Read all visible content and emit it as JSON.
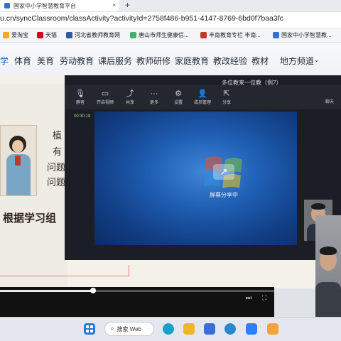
{
  "browser": {
    "tab_title": "国家中小学智慧教育平台",
    "tab_close": "×",
    "new_tab": "+",
    "address": "u.cn/syncClassroom/classActivity?activityId=2758f486-b951-4147-8769-6bd0f7baa3fc",
    "bookmarks": [
      {
        "label": "爱淘宝",
        "color": "#f5a623"
      },
      {
        "label": "天猫",
        "color": "#d0021b"
      },
      {
        "label": "河北省教师教育网",
        "color": "#2c5aa0"
      },
      {
        "label": "唐山市师生健康信...",
        "color": "#3bb36d"
      },
      {
        "label": "丰南教育专栏  丰南...",
        "color": "#c0392b"
      },
      {
        "label": "国家中小学智慧教...",
        "color": "#2f6fd6"
      }
    ]
  },
  "site_nav": {
    "items": [
      "学",
      "体育",
      "美育",
      "劳动教育",
      "课后服务",
      "教师研修",
      "家庭教育",
      "教改经验",
      "教材",
      "地方频道"
    ],
    "dropdown_icon": "chevron-down-icon",
    "accent": "#1e63c8"
  },
  "slide": {
    "lines": [
      "植",
      "有",
      "问题",
      "问题"
    ],
    "big_line": "根据学习组"
  },
  "meeting": {
    "title": "多位教来一位教（例7）",
    "record_time": "00:30:18",
    "tools": [
      {
        "icon": "mic-icon",
        "glyph": "🎙",
        "label": "静音"
      },
      {
        "icon": "camera-icon",
        "glyph": "▭",
        "label": "开启视频"
      },
      {
        "icon": "share-icon",
        "glyph": "⤴",
        "label": "共享"
      },
      {
        "icon": "more-icon",
        "glyph": "···",
        "label": "更多"
      },
      {
        "icon": "settings-icon",
        "glyph": "⚙",
        "label": "设置"
      },
      {
        "icon": "members-icon",
        "glyph": "👤",
        "label": "成员管理"
      },
      {
        "icon": "leave-icon",
        "glyph": "⇱",
        "label": "分享"
      }
    ],
    "side_label": "聊天",
    "share_status": "屏幕分享中"
  },
  "player": {
    "progress_fraction": 0.34,
    "next_glyph": "⏭",
    "fullscreen_glyph": "⛶"
  },
  "taskbar": {
    "search_label": "搜索 Web",
    "search_icon": "search-icon",
    "apps": [
      {
        "name": "windows-start-icon",
        "color": "#1f7ae0"
      },
      {
        "name": "edge-icon",
        "color": "#1aa0c8"
      },
      {
        "name": "file-explorer-icon",
        "color": "#f0b429"
      },
      {
        "name": "store-icon",
        "color": "#3a6fd8"
      },
      {
        "name": "ie-icon",
        "color": "#2a87d0"
      },
      {
        "name": "meeting-app-icon",
        "color": "#2d7ff9"
      },
      {
        "name": "media-app-icon",
        "color": "#f2a33a"
      }
    ]
  }
}
